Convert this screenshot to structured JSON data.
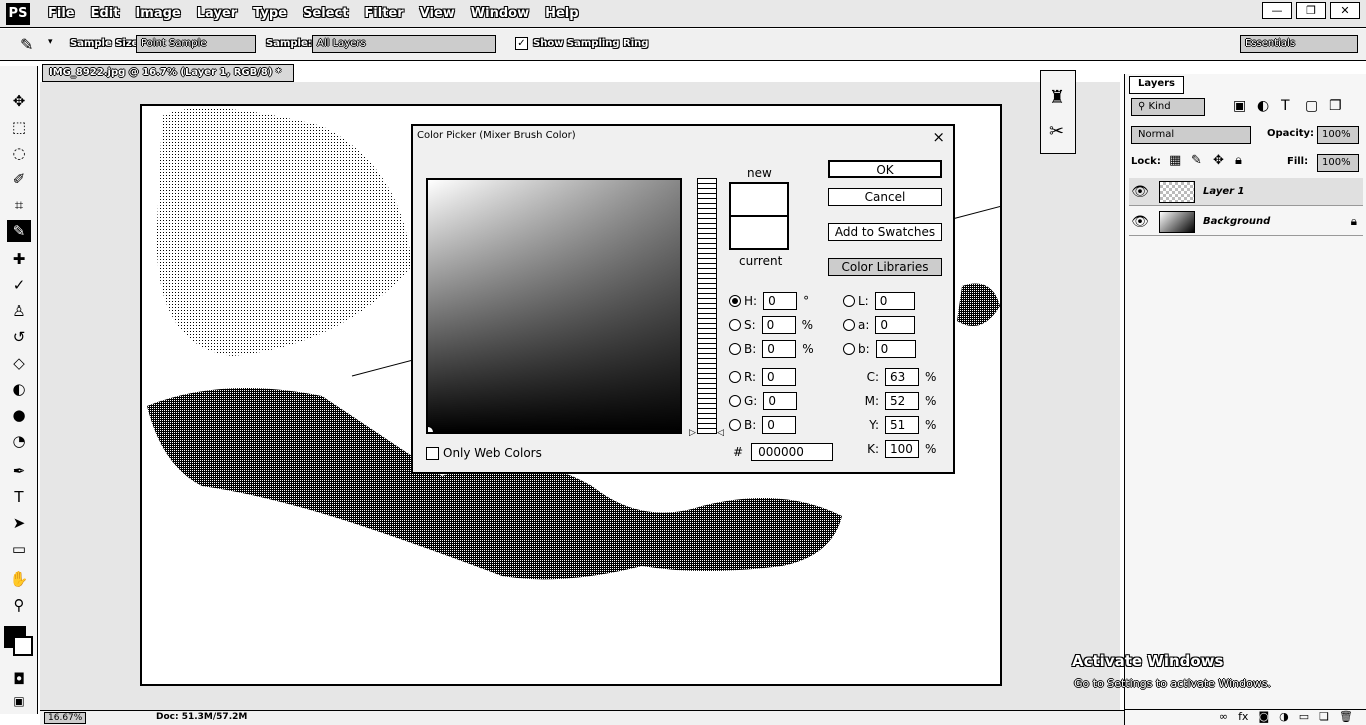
{
  "app": {
    "logo": "PS"
  },
  "menu": [
    "File",
    "Edit",
    "Image",
    "Layer",
    "Type",
    "Select",
    "Filter",
    "View",
    "Window",
    "Help"
  ],
  "window_controls": {
    "minimize": "—",
    "restore": "❐",
    "close": "✕"
  },
  "options": {
    "sample_size_label": "Sample Size:",
    "sample_size_value": "Point Sample",
    "sample_label": "Sample:",
    "sample_value": "All Layers",
    "show_ring_label": "Show Sampling Ring",
    "show_ring_checked": true,
    "workspace": "Essentials"
  },
  "document": {
    "tab_title": "IMG_8922.jpg @ 16.7% (Layer 1, RGB/8) *",
    "tab_close": "×",
    "zoom": "16.67%",
    "doc_size": "Doc: 51.3M/57.2M"
  },
  "layers": {
    "tab": "Layers",
    "kind": "Kind",
    "blend_mode": "Normal",
    "opacity_label": "Opacity:",
    "opacity": "100%",
    "lock_label": "Lock:",
    "fill_label": "Fill:",
    "fill": "100%",
    "items": [
      {
        "name": "Layer 1",
        "visible": true
      },
      {
        "name": "Background",
        "visible": true,
        "locked": true
      }
    ]
  },
  "color_picker": {
    "title": "Color Picker (Mixer Brush Color)",
    "close": "×",
    "new_label": "new",
    "current_label": "current",
    "buttons": {
      "ok": "OK",
      "cancel": "Cancel",
      "add_swatches": "Add to Swatches",
      "libraries": "Color Libraries"
    },
    "hsb": {
      "h": "0",
      "s": "0",
      "b": "0",
      "h_unit": "°",
      "s_unit": "%",
      "b_unit": "%"
    },
    "rgb": {
      "r": "0",
      "g": "0",
      "b": "0"
    },
    "lab": {
      "l": "0",
      "a": "0",
      "b": "0"
    },
    "cmyk": {
      "c": "63",
      "m": "52",
      "y": "51",
      "k": "100",
      "unit": "%"
    },
    "hex_label": "#",
    "hex": "000000",
    "web_only_label": "Only Web Colors",
    "labels": {
      "h": "H:",
      "s": "S:",
      "bb": "B:",
      "r": "R:",
      "g": "G:",
      "b": "B:",
      "l": "L:",
      "a": "a:",
      "lb": "b:",
      "c": "C:",
      "m": "M:",
      "y": "Y:",
      "k": "K:"
    }
  },
  "watermark": {
    "title": "Activate Windows",
    "subtitle": "Go to Settings to activate Windows."
  }
}
